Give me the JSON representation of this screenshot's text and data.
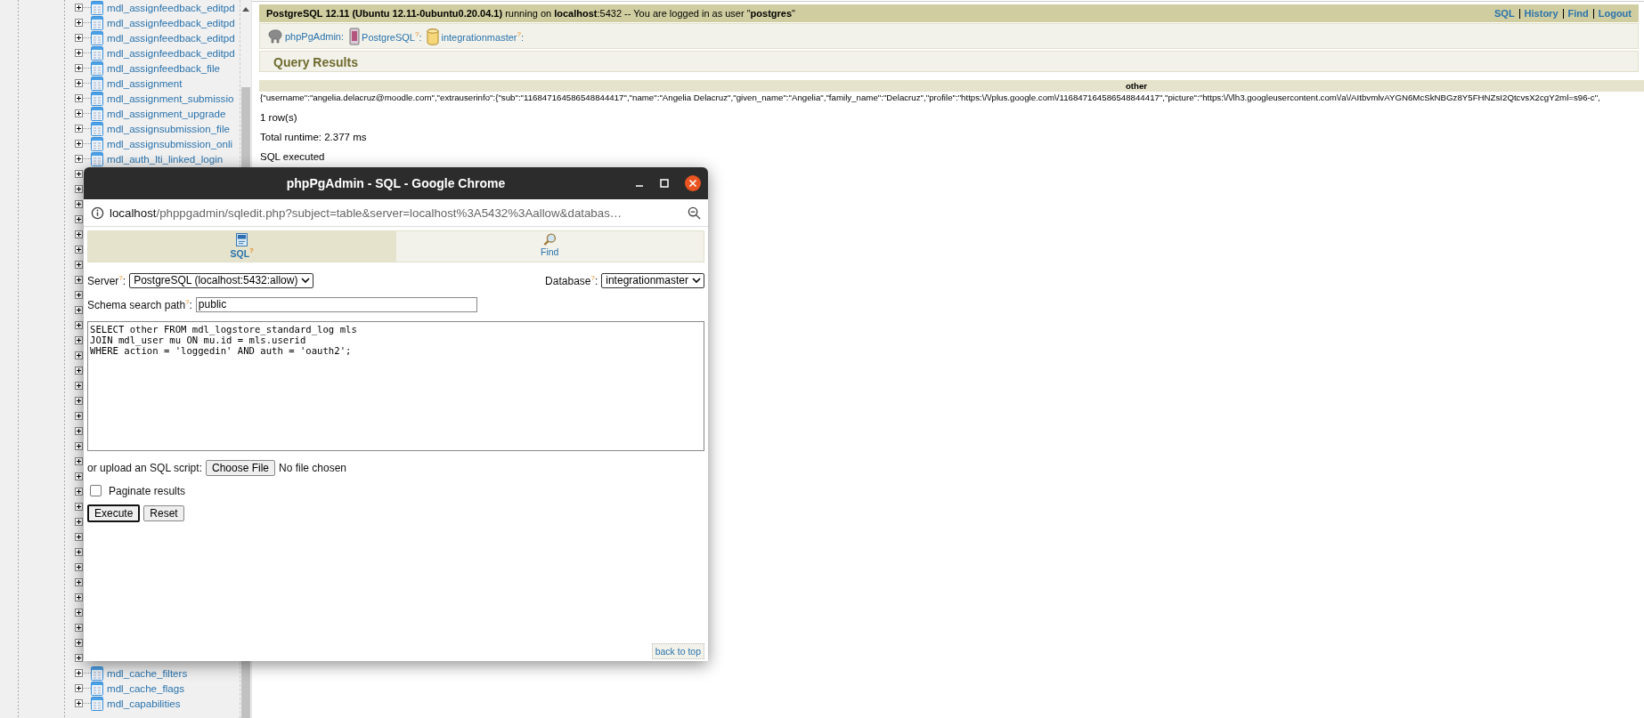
{
  "sidebar": {
    "items": [
      {
        "label": "mdl_assignfeedback_editpd",
        "collapsed": true
      },
      {
        "label": "mdl_assignfeedback_editpd",
        "collapsed": true
      },
      {
        "label": "mdl_assignfeedback_editpd",
        "collapsed": true
      },
      {
        "label": "mdl_assignfeedback_editpd",
        "collapsed": true
      },
      {
        "label": "mdl_assignfeedback_file",
        "collapsed": true
      },
      {
        "label": "mdl_assignment",
        "collapsed": true
      },
      {
        "label": "mdl_assignment_submissio",
        "collapsed": true
      },
      {
        "label": "mdl_assignment_upgrade",
        "collapsed": true
      },
      {
        "label": "mdl_assignsubmission_file",
        "collapsed": true
      },
      {
        "label": "mdl_assignsubmission_onli",
        "collapsed": true
      },
      {
        "label": "mdl_auth_lti_linked_login",
        "collapsed": true
      },
      {
        "collapsed": true
      },
      {
        "collapsed": true
      },
      {
        "collapsed": true
      },
      {
        "collapsed": true
      },
      {
        "collapsed": true
      },
      {
        "collapsed": true
      },
      {
        "collapsed": true
      },
      {
        "collapsed": true
      },
      {
        "collapsed": true
      },
      {
        "collapsed": true
      },
      {
        "collapsed": true
      },
      {
        "collapsed": true
      },
      {
        "collapsed": true
      },
      {
        "collapsed": true
      },
      {
        "collapsed": true
      },
      {
        "collapsed": true
      },
      {
        "collapsed": true
      },
      {
        "collapsed": true
      },
      {
        "collapsed": true
      },
      {
        "collapsed": true
      },
      {
        "collapsed": true
      },
      {
        "collapsed": true
      },
      {
        "collapsed": true
      },
      {
        "collapsed": true
      },
      {
        "collapsed": true
      },
      {
        "collapsed": true
      },
      {
        "collapsed": true
      },
      {
        "collapsed": true
      },
      {
        "collapsed": true
      },
      {
        "collapsed": true
      },
      {
        "collapsed": true
      },
      {
        "collapsed": true
      },
      {
        "collapsed": true
      },
      {
        "label": "mdl_cache_filters",
        "collapsed": true
      },
      {
        "label": "mdl_cache_flags",
        "collapsed": true
      },
      {
        "label": "mdl_capabilities",
        "collapsed": true
      }
    ]
  },
  "top_bar": {
    "server_info": "**PostgreSQL 12.11 (Ubuntu 12.11-0ubuntu0.20.04.1)** running on **localhost**:5432 -- You are logged in as user \"**postgres**\"",
    "links": [
      "SQL",
      "History",
      "Find",
      "Logout"
    ]
  },
  "breadcrumb": [
    {
      "kind": "app",
      "label": "phpPgAdmin:"
    },
    {
      "kind": "server",
      "label": "PostgreSQL$^{?}$:"
    },
    {
      "kind": "database",
      "label": "integrationmaster$^{?}$:"
    }
  ],
  "section_title": "Query Results",
  "results": {
    "columns": [
      "other"
    ],
    "rows": [
      [
        "{\"username\":\"angelia.delacruz@moodle.com\",\"extrauserinfo\":{\"sub\":\"116847164586548844417\",\"name\":\"Angelia Delacruz\",\"given_name\":\"Angelia\",\"family_name\":\"Delacruz\",\"profile\":\"https:\\/\\/plus.google.com\\/116847164586548844417\",\"picture\":\"https:\\/\\/lh3.googleusercontent.com\\/a\\/AItbvmlvAYGN6McSkNBGz8Y5FHNZsI2QtcvsX2cgY2ml=s96-c\","
      ]
    ]
  },
  "row_count": "1 row(s)",
  "runtime": "Total runtime: 2.377 ms",
  "status": "SQL executed",
  "popup": {
    "title": "phpPgAdmin - SQL - Google Chrome",
    "url_host": "localhost",
    "url_path": "/phppgadmin/sqledit.php?subject=table&server=localhost%3A5432%3Aallow&databas…",
    "tabs": [
      {
        "kind": "sql",
        "label": "SQL$^{?}$",
        "selected": true
      },
      {
        "kind": "find",
        "label": "Find",
        "selected": false
      }
    ],
    "server_label": "Server$^{?}$:",
    "server_value": "PostgreSQL (localhost:5432:allow)",
    "database_label": "Database$^{?}$:",
    "database_value": "integrationmaster",
    "schema_label": "Schema search path$^{?}$:",
    "schema_value": "public",
    "query": "SELECT other FROM mdl_logstore_standard_log mls\nJOIN mdl_user mu ON mu.id = mls.userid\nWHERE action = 'loggedin' AND auth = 'oauth2';",
    "upload_label": "or upload an SQL script:",
    "file_button": "Choose File",
    "file_status": "No file chosen",
    "paginate": {
      "label": "Paginate results",
      "checked": false
    },
    "buttons": [
      {
        "label": "Execute",
        "focused": true
      },
      {
        "label": "Reset",
        "focused": false
      }
    ],
    "back_to_top": "back to top"
  }
}
